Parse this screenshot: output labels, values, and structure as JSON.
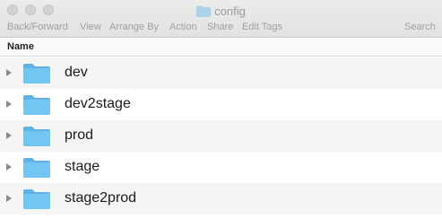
{
  "window": {
    "title": "config"
  },
  "toolbar": {
    "back_forward": "Back/Forward",
    "view": "View",
    "arrange_by": "Arrange By",
    "action": "Action",
    "share": "Share",
    "edit_tags": "Edit Tags",
    "search": "Search"
  },
  "list": {
    "column_header": "Name",
    "items": [
      {
        "name": "dev",
        "icon": "folder-icon"
      },
      {
        "name": "dev2stage",
        "icon": "folder-icon"
      },
      {
        "name": "prod",
        "icon": "folder-icon"
      },
      {
        "name": "stage",
        "icon": "folder-icon"
      },
      {
        "name": "stage2prod",
        "icon": "folder-icon"
      }
    ]
  },
  "colors": {
    "folder": "#6fc3f0",
    "folder_tab": "#5fb2e3"
  }
}
